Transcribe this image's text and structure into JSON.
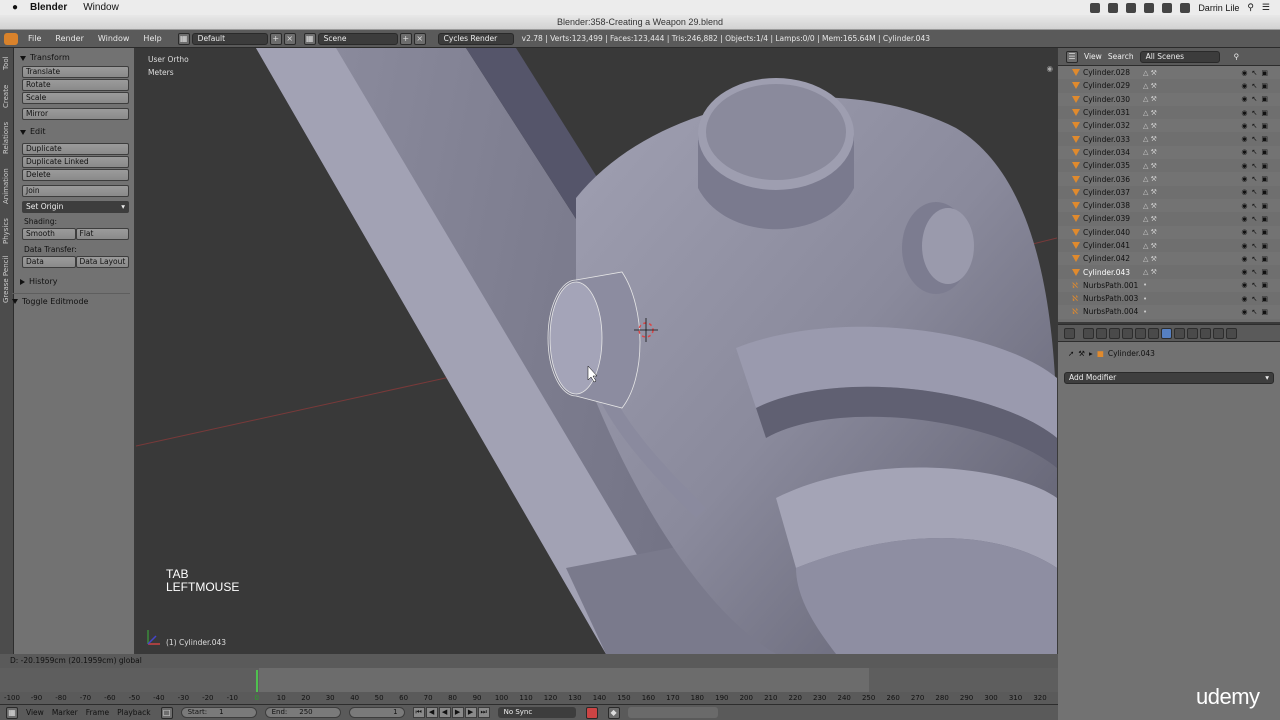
{
  "mac_menubar": {
    "app_name": "Blender",
    "menu_window": "Window",
    "user": "Darrin Lile"
  },
  "window_title": "Blender:358-Creating a Weapon 29.blend",
  "info_header": {
    "menu": [
      "File",
      "Render",
      "Window",
      "Help"
    ],
    "layout": "Default",
    "scene": "Scene",
    "engine": "Cycles Render",
    "stats": "v2.78 | Verts:123,499 | Faces:123,444 | Tris:246,882 | Objects:1/4 | Lamps:0/0 | Mem:165.64M | Cylinder.043"
  },
  "tool_tabs": [
    "Tool",
    "Create",
    "Relations",
    "Animation",
    "Physics",
    "Grease Pencil"
  ],
  "tool_shelf": {
    "transform_header": "Transform",
    "transform_buttons": [
      "Translate",
      "Rotate",
      "Scale"
    ],
    "mirror": "Mirror",
    "edit_header": "Edit",
    "edit_buttons": [
      "Duplicate",
      "Duplicate Linked",
      "Delete"
    ],
    "join": "Join",
    "set_origin": "Set Origin",
    "shading_label": "Shading:",
    "smooth": "Smooth",
    "flat": "Flat",
    "data_transfer_label": "Data Transfer:",
    "data": "Data",
    "data_layout": "Data Layout",
    "history_header": "History",
    "toggle_editmode": "Toggle Editmode"
  },
  "viewport": {
    "view_name": "User Ortho",
    "units": "Meters",
    "key_line1": "TAB",
    "key_line2": "LEFTMOUSE",
    "active_object": "(1) Cylinder.043"
  },
  "outliner": {
    "view": "View",
    "search": "Search",
    "filter": "All Scenes",
    "rows": [
      {
        "name": "Cylinder.028",
        "type": "mesh",
        "selected": false
      },
      {
        "name": "Cylinder.029",
        "type": "mesh",
        "selected": false
      },
      {
        "name": "Cylinder.030",
        "type": "mesh",
        "selected": false
      },
      {
        "name": "Cylinder.031",
        "type": "mesh",
        "selected": false
      },
      {
        "name": "Cylinder.032",
        "type": "mesh",
        "selected": false
      },
      {
        "name": "Cylinder.033",
        "type": "mesh",
        "selected": false
      },
      {
        "name": "Cylinder.034",
        "type": "mesh",
        "selected": false
      },
      {
        "name": "Cylinder.035",
        "type": "mesh",
        "selected": false
      },
      {
        "name": "Cylinder.036",
        "type": "mesh",
        "selected": false
      },
      {
        "name": "Cylinder.037",
        "type": "mesh",
        "selected": false
      },
      {
        "name": "Cylinder.038",
        "type": "mesh",
        "selected": false
      },
      {
        "name": "Cylinder.039",
        "type": "mesh",
        "selected": false
      },
      {
        "name": "Cylinder.040",
        "type": "mesh",
        "selected": false
      },
      {
        "name": "Cylinder.041",
        "type": "mesh",
        "selected": false
      },
      {
        "name": "Cylinder.042",
        "type": "mesh",
        "selected": false
      },
      {
        "name": "Cylinder.043",
        "type": "mesh",
        "selected": true
      },
      {
        "name": "NurbsPath.001",
        "type": "curve",
        "selected": false
      },
      {
        "name": "NurbsPath.003",
        "type": "curve",
        "selected": false
      },
      {
        "name": "NurbsPath.004",
        "type": "curve",
        "selected": false
      }
    ]
  },
  "properties": {
    "object_name": "Cylinder.043",
    "add_modifier": "Add Modifier"
  },
  "status_line": "D: -20.1959cm (20.1959cm) global",
  "timeline": {
    "current_frame": 0,
    "ticks": [
      -100,
      -90,
      -80,
      -70,
      -60,
      -50,
      -40,
      -30,
      -20,
      -10,
      0,
      10,
      20,
      30,
      40,
      50,
      60,
      70,
      80,
      90,
      100,
      110,
      120,
      130,
      140,
      150,
      160,
      170,
      180,
      190,
      200,
      210,
      220,
      230,
      240,
      250,
      260,
      270,
      280,
      290,
      300,
      310,
      320
    ]
  },
  "timeline_header": {
    "menu": [
      "View",
      "Marker",
      "Frame",
      "Playback"
    ],
    "start_label": "Start:",
    "start_value": "1",
    "end_label": "End:",
    "end_value": "250",
    "current": "1",
    "sync": "No Sync"
  },
  "watermark": "udemy",
  "colors": {
    "accent_orange": "#e08a2d",
    "selected_blue": "#5680c2",
    "frame_cursor_green": "#4fc14f"
  }
}
